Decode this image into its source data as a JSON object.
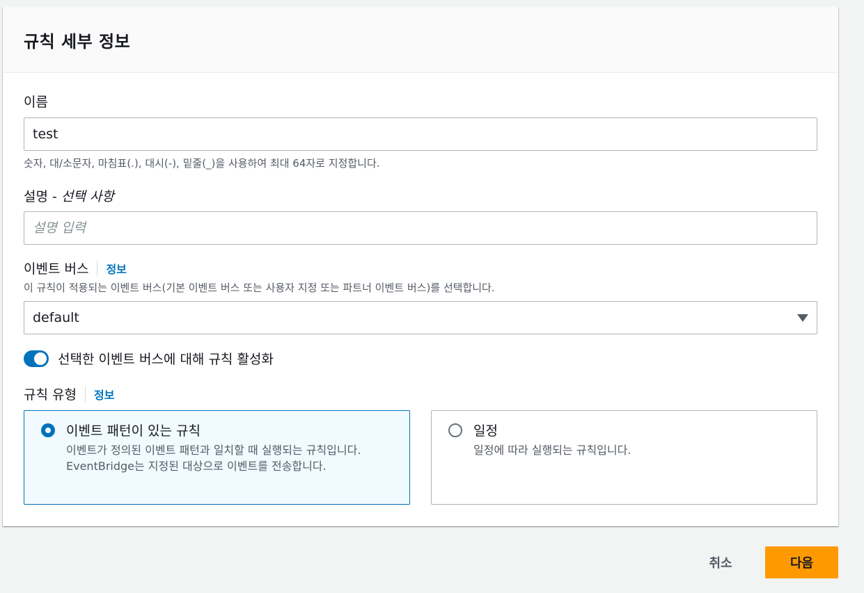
{
  "panel": {
    "title": "규칙 세부 정보"
  },
  "name_field": {
    "label": "이름",
    "value": "test",
    "hint": "숫자, 대/소문자, 마침표(.), 대시(-), 밑줄(_)을 사용하여 최대 64자로 지정합니다."
  },
  "description_field": {
    "label": "설명 - ",
    "label_optional": "선택 사항",
    "placeholder": "설명 입력"
  },
  "event_bus": {
    "label": "이벤트 버스",
    "info_link": "정보",
    "hint": "이 규칙이 적용되는 이벤트 버스(기본 이벤트 버스 또는 사용자 지정 또는 파트너 이벤트 버스)를 선택합니다.",
    "selected": "default"
  },
  "enable_toggle": {
    "label": "선택한 이벤트 버스에 대해 규칙 활성화",
    "checked": true
  },
  "rule_type": {
    "label": "규칙 유형",
    "info_link": "정보",
    "options": [
      {
        "title": "이벤트 패턴이 있는 규칙",
        "description": "이벤트가 정의된 이벤트 패턴과 일치할 때 실행되는 규칙입니다. EventBridge는 지정된 대상으로 이벤트를 전송합니다.",
        "selected": true
      },
      {
        "title": "일정",
        "description": "일정에 따라 실행되는 규칙입니다.",
        "selected": false
      }
    ]
  },
  "actions": {
    "cancel": "취소",
    "next": "다음"
  },
  "colors": {
    "accent": "#0073bb",
    "primary_button": "#ff9900"
  }
}
